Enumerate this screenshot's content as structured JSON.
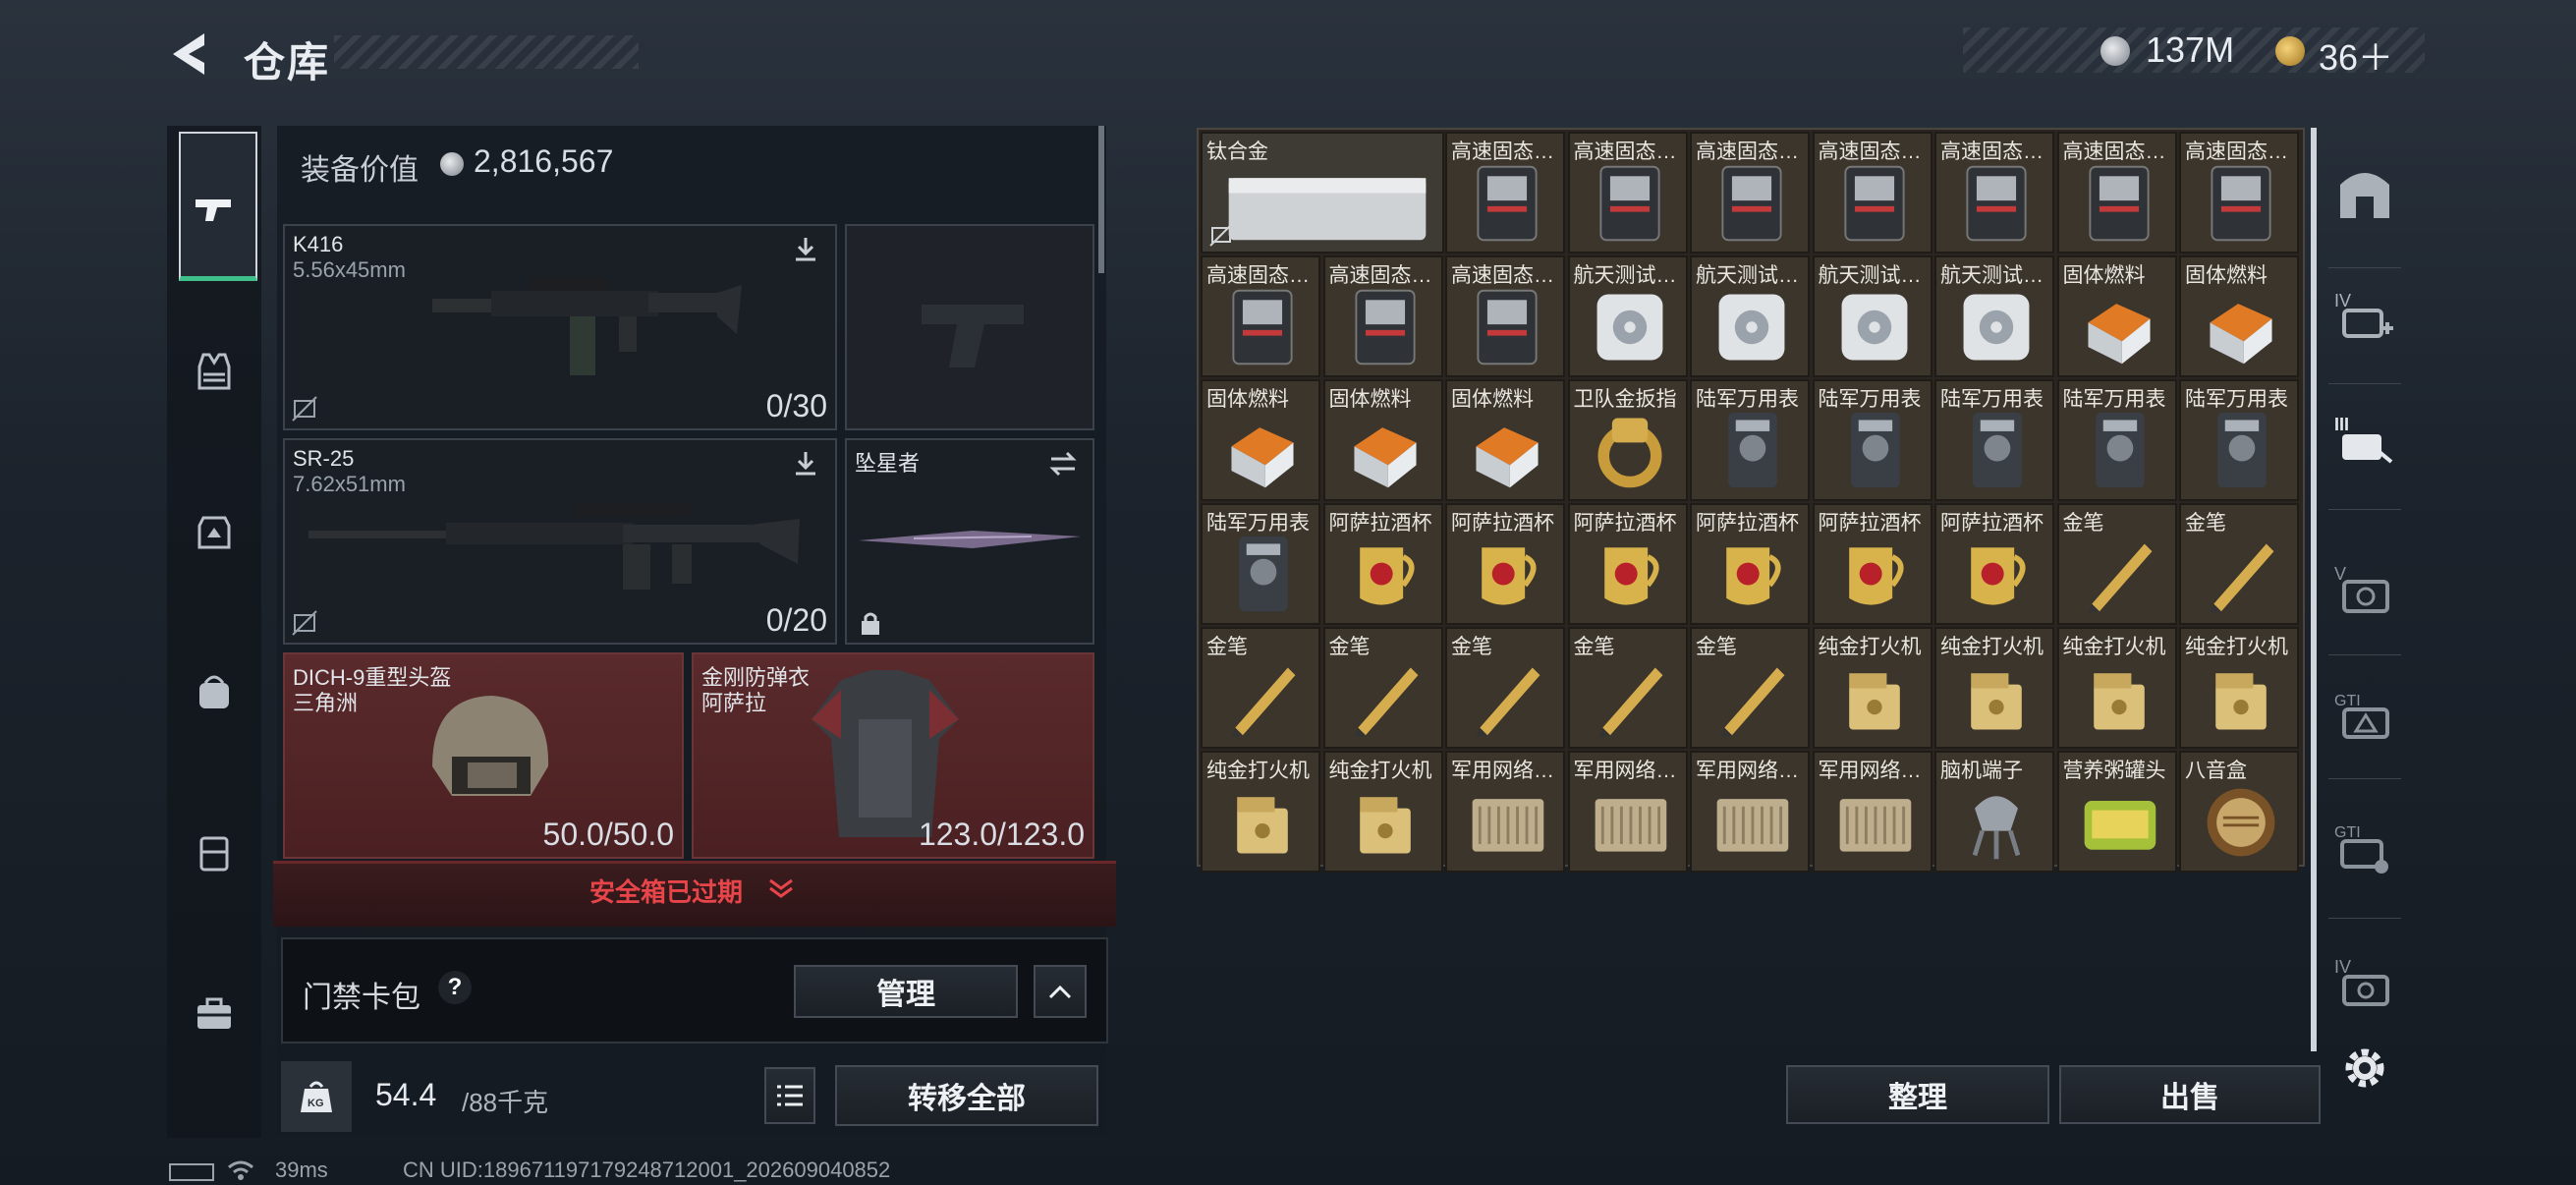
{
  "header": {
    "title": "仓库",
    "currency1": "137M",
    "currency2": "36＋"
  },
  "equipment": {
    "value_label": "装备价值",
    "value": "2,816,567",
    "primary": {
      "name": "K416",
      "caliber": "5.56x45mm",
      "ammo": "0/30"
    },
    "secondary": {
      "name": "SR-25",
      "caliber": "7.62x51mm",
      "ammo": "0/20"
    },
    "melee": {
      "name": "坠星者"
    },
    "helmet": {
      "name": "DICH-9重型头盔",
      "sub": "三角洲",
      "durability": "50.0/50.0"
    },
    "armor": {
      "name": "金刚防弹衣",
      "sub": "阿萨拉",
      "durability": "123.0/123.0"
    },
    "safebox": "安全箱已过期",
    "keycard_label": "门禁卡包",
    "keycard_help": "?",
    "manage_button": "管理",
    "weight": "54.4",
    "weight_max": "/88千克",
    "transfer_all_button": "转移全部"
  },
  "inventory": {
    "items": [
      {
        "label": "钛合金",
        "icon": "metal-bar"
      },
      {
        "label": "高速固态…",
        "icon": "ssd"
      },
      {
        "label": "高速固态…",
        "icon": "ssd"
      },
      {
        "label": "高速固态…",
        "icon": "ssd"
      },
      {
        "label": "高速固态…",
        "icon": "ssd"
      },
      {
        "label": "高速固态…",
        "icon": "ssd"
      },
      {
        "label": "高速固态…",
        "icon": "ssd"
      },
      {
        "label": "高速固态…",
        "icon": "ssd"
      },
      {
        "label": "高速固态…",
        "icon": "ssd"
      },
      {
        "label": "高速固态…",
        "icon": "ssd"
      },
      {
        "label": "高速固态…",
        "icon": "ssd"
      },
      {
        "label": "航天测试…",
        "icon": "test-disk"
      },
      {
        "label": "航天测试…",
        "icon": "test-disk"
      },
      {
        "label": "航天测试…",
        "icon": "test-disk"
      },
      {
        "label": "航天测试…",
        "icon": "test-disk"
      },
      {
        "label": "固体燃料",
        "icon": "fuel"
      },
      {
        "label": "固体燃料",
        "icon": "fuel"
      },
      {
        "label": "固体燃料",
        "icon": "fuel"
      },
      {
        "label": "固体燃料",
        "icon": "fuel"
      },
      {
        "label": "固体燃料",
        "icon": "fuel"
      },
      {
        "label": "卫队金扳指",
        "icon": "gold-ring"
      },
      {
        "label": "陆军万用表",
        "icon": "multimeter"
      },
      {
        "label": "陆军万用表",
        "icon": "multimeter"
      },
      {
        "label": "陆军万用表",
        "icon": "multimeter"
      },
      {
        "label": "陆军万用表",
        "icon": "multimeter"
      },
      {
        "label": "陆军万用表",
        "icon": "multimeter"
      },
      {
        "label": "陆军万用表",
        "icon": "multimeter"
      },
      {
        "label": "阿萨拉酒杯",
        "icon": "cup"
      },
      {
        "label": "阿萨拉酒杯",
        "icon": "cup"
      },
      {
        "label": "阿萨拉酒杯",
        "icon": "cup"
      },
      {
        "label": "阿萨拉酒杯",
        "icon": "cup"
      },
      {
        "label": "阿萨拉酒杯",
        "icon": "cup"
      },
      {
        "label": "阿萨拉酒杯",
        "icon": "cup"
      },
      {
        "label": "金笔",
        "icon": "gold-pen"
      },
      {
        "label": "金笔",
        "icon": "gold-pen"
      },
      {
        "label": "金笔",
        "icon": "gold-pen"
      },
      {
        "label": "金笔",
        "icon": "gold-pen"
      },
      {
        "label": "金笔",
        "icon": "gold-pen"
      },
      {
        "label": "金笔",
        "icon": "gold-pen"
      },
      {
        "label": "金笔",
        "icon": "gold-pen"
      },
      {
        "label": "纯金打火机",
        "icon": "lighter"
      },
      {
        "label": "纯金打火机",
        "icon": "lighter"
      },
      {
        "label": "纯金打火机",
        "icon": "lighter"
      },
      {
        "label": "纯金打火机",
        "icon": "lighter"
      },
      {
        "label": "纯金打火机",
        "icon": "lighter"
      },
      {
        "label": "纯金打火机",
        "icon": "lighter"
      },
      {
        "label": "军用网络…",
        "icon": "network-box"
      },
      {
        "label": "军用网络…",
        "icon": "network-box"
      },
      {
        "label": "军用网络…",
        "icon": "network-box"
      },
      {
        "label": "军用网络…",
        "icon": "network-box"
      },
      {
        "label": "脑机端子",
        "icon": "brain-terminal"
      },
      {
        "label": "营养粥罐头",
        "icon": "can"
      },
      {
        "label": "八音盒",
        "icon": "music-box"
      }
    ],
    "sort_button": "整理",
    "sell_button": "出售"
  },
  "footer": {
    "ping": "39ms",
    "uid": "CN UID:18967119717924871200​1_202609040852"
  },
  "colors": {
    "accent_green": "#3fc08a",
    "danger_red": "#e8454a",
    "gold": "#d6a84a"
  }
}
